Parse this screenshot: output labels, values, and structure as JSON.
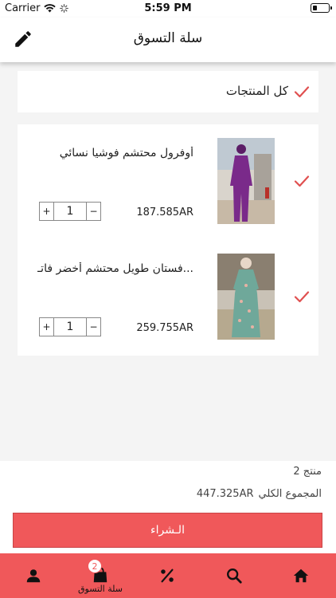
{
  "status_bar": {
    "carrier": "Carrier",
    "time": "5:59 PM"
  },
  "header": {
    "title": "سلة التسوق",
    "edit_icon": "pencil-icon"
  },
  "select_all": {
    "label": "كل المنتجات",
    "checked": true
  },
  "items": [
    {
      "name": "أوفرول محتشم فوشيا نسائي",
      "price": "187.585AR",
      "quantity": "1",
      "checked": true,
      "dress_color": "#7a2a8a"
    },
    {
      "name": "فستان طويل محتشم أخضر فاتـ...",
      "price": "259.755AR",
      "quantity": "1",
      "checked": true,
      "dress_color": "#6fa89a"
    }
  ],
  "qty_controls": {
    "plus": "+",
    "minus": "−"
  },
  "summary": {
    "count_text": "2 منتج",
    "total_label": "المجموع الكلي",
    "total_value": "447.325AR"
  },
  "checkout": {
    "label": "الـشراء"
  },
  "tabs": [
    {
      "name": "profile",
      "icon": "person-icon",
      "label": ""
    },
    {
      "name": "cart",
      "icon": "bag-icon",
      "label": "سلة التسوق",
      "badge": "2"
    },
    {
      "name": "offers",
      "icon": "percent-icon",
      "label": ""
    },
    {
      "name": "search",
      "icon": "search-icon",
      "label": ""
    },
    {
      "name": "home",
      "icon": "home-icon",
      "label": ""
    }
  ],
  "colors": {
    "accent": "#f0585a",
    "check": "#e05050"
  }
}
